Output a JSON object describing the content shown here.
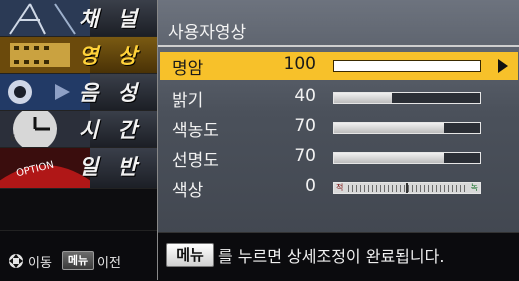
{
  "sidebar": {
    "items": [
      {
        "label": "채 널",
        "icon": "antenna-icon",
        "active": false
      },
      {
        "label": "영 상",
        "icon": "film-icon",
        "active": true
      },
      {
        "label": "음 성",
        "icon": "speaker-icon",
        "active": false
      },
      {
        "label": "시 간",
        "icon": "clock-icon",
        "active": false
      },
      {
        "label": "일 반",
        "icon": "option-icon",
        "thumb_text": "OPTION",
        "active": false
      }
    ],
    "footer": {
      "move_label": "이동",
      "menu_key": "메뉴",
      "prev_label": "이전"
    }
  },
  "panel": {
    "title": "사용자영상",
    "rows": [
      {
        "name": "명암",
        "value": "100",
        "level": 1.0,
        "selected": true
      },
      {
        "name": "밝기",
        "value": "40",
        "level": 0.4,
        "selected": false
      },
      {
        "name": "색농도",
        "value": "70",
        "level": 0.75,
        "selected": false
      },
      {
        "name": "선명도",
        "value": "70",
        "level": 0.75,
        "selected": false
      },
      {
        "name": "색상",
        "value": "0",
        "tint_left": "적",
        "tint_right": "녹",
        "selected": false
      }
    ],
    "footer": {
      "menu_button": "메뉴",
      "message": "를 누르면 상세조정이 완료됩니다."
    }
  },
  "colors": {
    "selected_row": "#f7c12a",
    "active_category_text": "#ffd23a"
  }
}
